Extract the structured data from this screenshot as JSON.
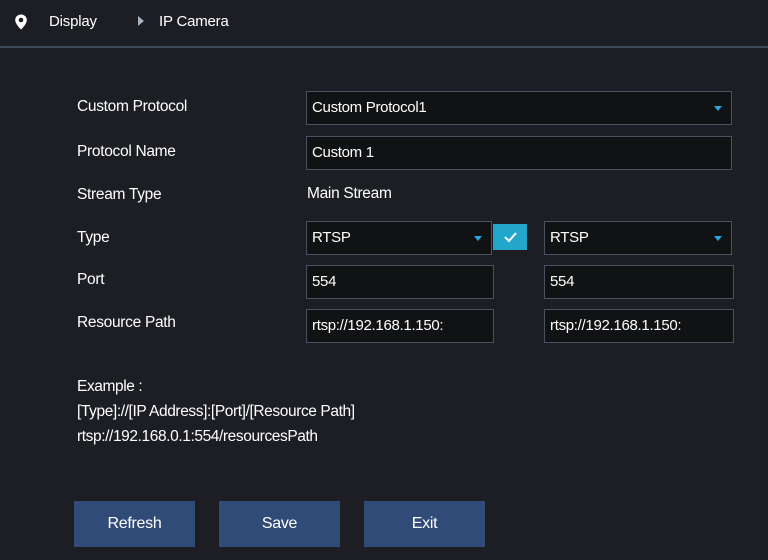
{
  "breadcrumb": {
    "icon": "location-pin-icon",
    "items": [
      "Display",
      "IP Camera"
    ],
    "separator_icon": "triangle-right-icon"
  },
  "form": {
    "custom_protocol": {
      "label": "Custom Protocol",
      "value": "Custom Protocol1"
    },
    "protocol_name": {
      "label": "Protocol Name",
      "value": "Custom 1"
    },
    "stream_type": {
      "label": "Stream Type",
      "value": "Main Stream"
    },
    "type": {
      "label": "Type",
      "main_value": "RTSP",
      "sub_value": "RTSP",
      "enabled_checked": true
    },
    "port": {
      "label": "Port",
      "main_value": "554",
      "sub_value": "554"
    },
    "resource_path": {
      "label": "Resource Path",
      "main_value": "rtsp://192.168.1.150:",
      "sub_value": "rtsp://192.168.1.150:"
    }
  },
  "example": {
    "title": "Example :",
    "format": "[Type]://[IP Address]:[Port]/[Resource Path]",
    "sample": "rtsp://192.168.0.1:554/resourcesPath"
  },
  "buttons": {
    "refresh": "Refresh",
    "save": "Save",
    "exit": "Exit"
  },
  "colors": {
    "background": "#1c1e23",
    "accent": "#2aa6e0",
    "button": "#314b78",
    "checkbox": "#22a6c9"
  }
}
